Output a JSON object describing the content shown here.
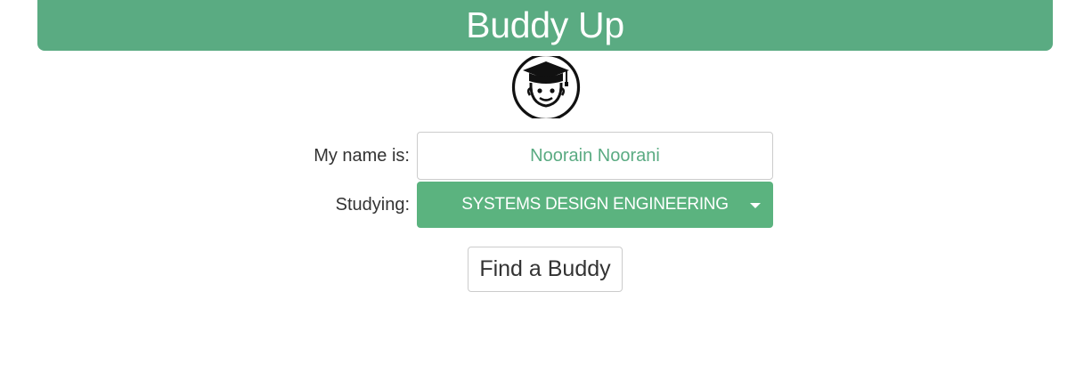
{
  "header": {
    "title": "Buddy Up"
  },
  "avatar": {
    "icon": "graduate-face-icon"
  },
  "form": {
    "name_label": "My name is:",
    "name_value": "Noorain Noorani",
    "study_label": "Studying:",
    "study_value": "SYSTEMS DESIGN ENGINEERING",
    "study_options": [
      "SYSTEMS DESIGN ENGINEERING"
    ]
  },
  "actions": {
    "find_label": "Find a Buddy"
  },
  "colors": {
    "brand": "#5aab82",
    "select_bg": "#5bb37f",
    "text": "#333333"
  }
}
